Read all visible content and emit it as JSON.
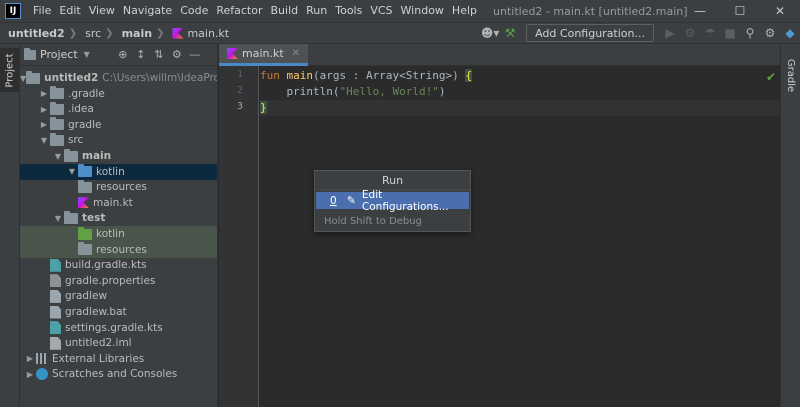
{
  "app": {
    "logo_text": "IJ",
    "window_title": "untitled2 - main.kt [untitled2.main]",
    "menu": [
      "File",
      "Edit",
      "View",
      "Navigate",
      "Code",
      "Refactor",
      "Build",
      "Run",
      "Tools",
      "VCS",
      "Window",
      "Help"
    ],
    "window_controls": [
      "minimize-icon",
      "maximize-icon",
      "close-icon"
    ]
  },
  "navbar": {
    "breadcrumbs": [
      "untitled2",
      "src",
      "main",
      "main.kt"
    ],
    "run_config_label": "Add Configuration...",
    "icons": [
      "user-icon",
      "hammer-icon",
      "run-icon",
      "debug-icon",
      "coverage-icon",
      "stop-icon",
      "search-icon",
      "gear-icon",
      "toolbox-icon"
    ]
  },
  "left_strip": {
    "label": "Project"
  },
  "right_strip": {
    "label": "Gradle"
  },
  "project_panel": {
    "title": "Project",
    "tree": [
      {
        "label": "untitled2",
        "hint": "C:\\Users\\willm\\IdeaProjects\\u",
        "depth": 0,
        "expanded": true,
        "icon": "folder",
        "bold": true
      },
      {
        "label": ".gradle",
        "depth": 1,
        "expanded": false,
        "icon": "folder"
      },
      {
        "label": ".idea",
        "depth": 1,
        "expanded": false,
        "icon": "folder"
      },
      {
        "label": "gradle",
        "depth": 1,
        "expanded": false,
        "icon": "folder"
      },
      {
        "label": "src",
        "depth": 1,
        "expanded": true,
        "icon": "folder"
      },
      {
        "label": "main",
        "depth": 2,
        "expanded": true,
        "icon": "folder",
        "bold": true
      },
      {
        "label": "kotlin",
        "depth": 3,
        "expanded": true,
        "icon": "folder-blue",
        "selected": true
      },
      {
        "label": "resources",
        "depth": 3,
        "icon": "folder-res"
      },
      {
        "label": "main.kt",
        "depth": 3,
        "icon": "kotlin-file"
      },
      {
        "label": "test",
        "depth": 2,
        "expanded": true,
        "icon": "folder",
        "bold": true
      },
      {
        "label": "kotlin",
        "depth": 3,
        "icon": "folder-green",
        "test": true
      },
      {
        "label": "resources",
        "depth": 3,
        "icon": "folder-res",
        "test": true
      },
      {
        "label": "build.gradle.kts",
        "depth": 1,
        "icon": "gradle-file"
      },
      {
        "label": "gradle.properties",
        "depth": 1,
        "icon": "properties-file"
      },
      {
        "label": "gradlew",
        "depth": 1,
        "icon": "file"
      },
      {
        "label": "gradlew.bat",
        "depth": 1,
        "icon": "file"
      },
      {
        "label": "settings.gradle.kts",
        "depth": 1,
        "icon": "gradle-file"
      },
      {
        "label": "untitled2.iml",
        "depth": 1,
        "icon": "iml-file"
      },
      {
        "label": "External Libraries",
        "depth": 0,
        "expanded": false,
        "icon": "library"
      },
      {
        "label": "Scratches and Consoles",
        "depth": 0,
        "expanded": false,
        "icon": "scratches"
      }
    ]
  },
  "editor": {
    "tab_label": "main.kt",
    "line_numbers": [
      "1",
      "2",
      "3"
    ],
    "code": {
      "line1_kw": "fun ",
      "line1_fn": "main",
      "line1_rest": "(args : Array<String>) ",
      "line1_brace": "{",
      "line2_pre": "    println(",
      "line2_str": "\"Hello, World!\"",
      "line2_post": ")",
      "line3_brace": "}"
    }
  },
  "popup": {
    "title": "Run",
    "item_number": "0",
    "item_label": "Edit Configurations...",
    "hint": "Hold Shift to Debug"
  }
}
